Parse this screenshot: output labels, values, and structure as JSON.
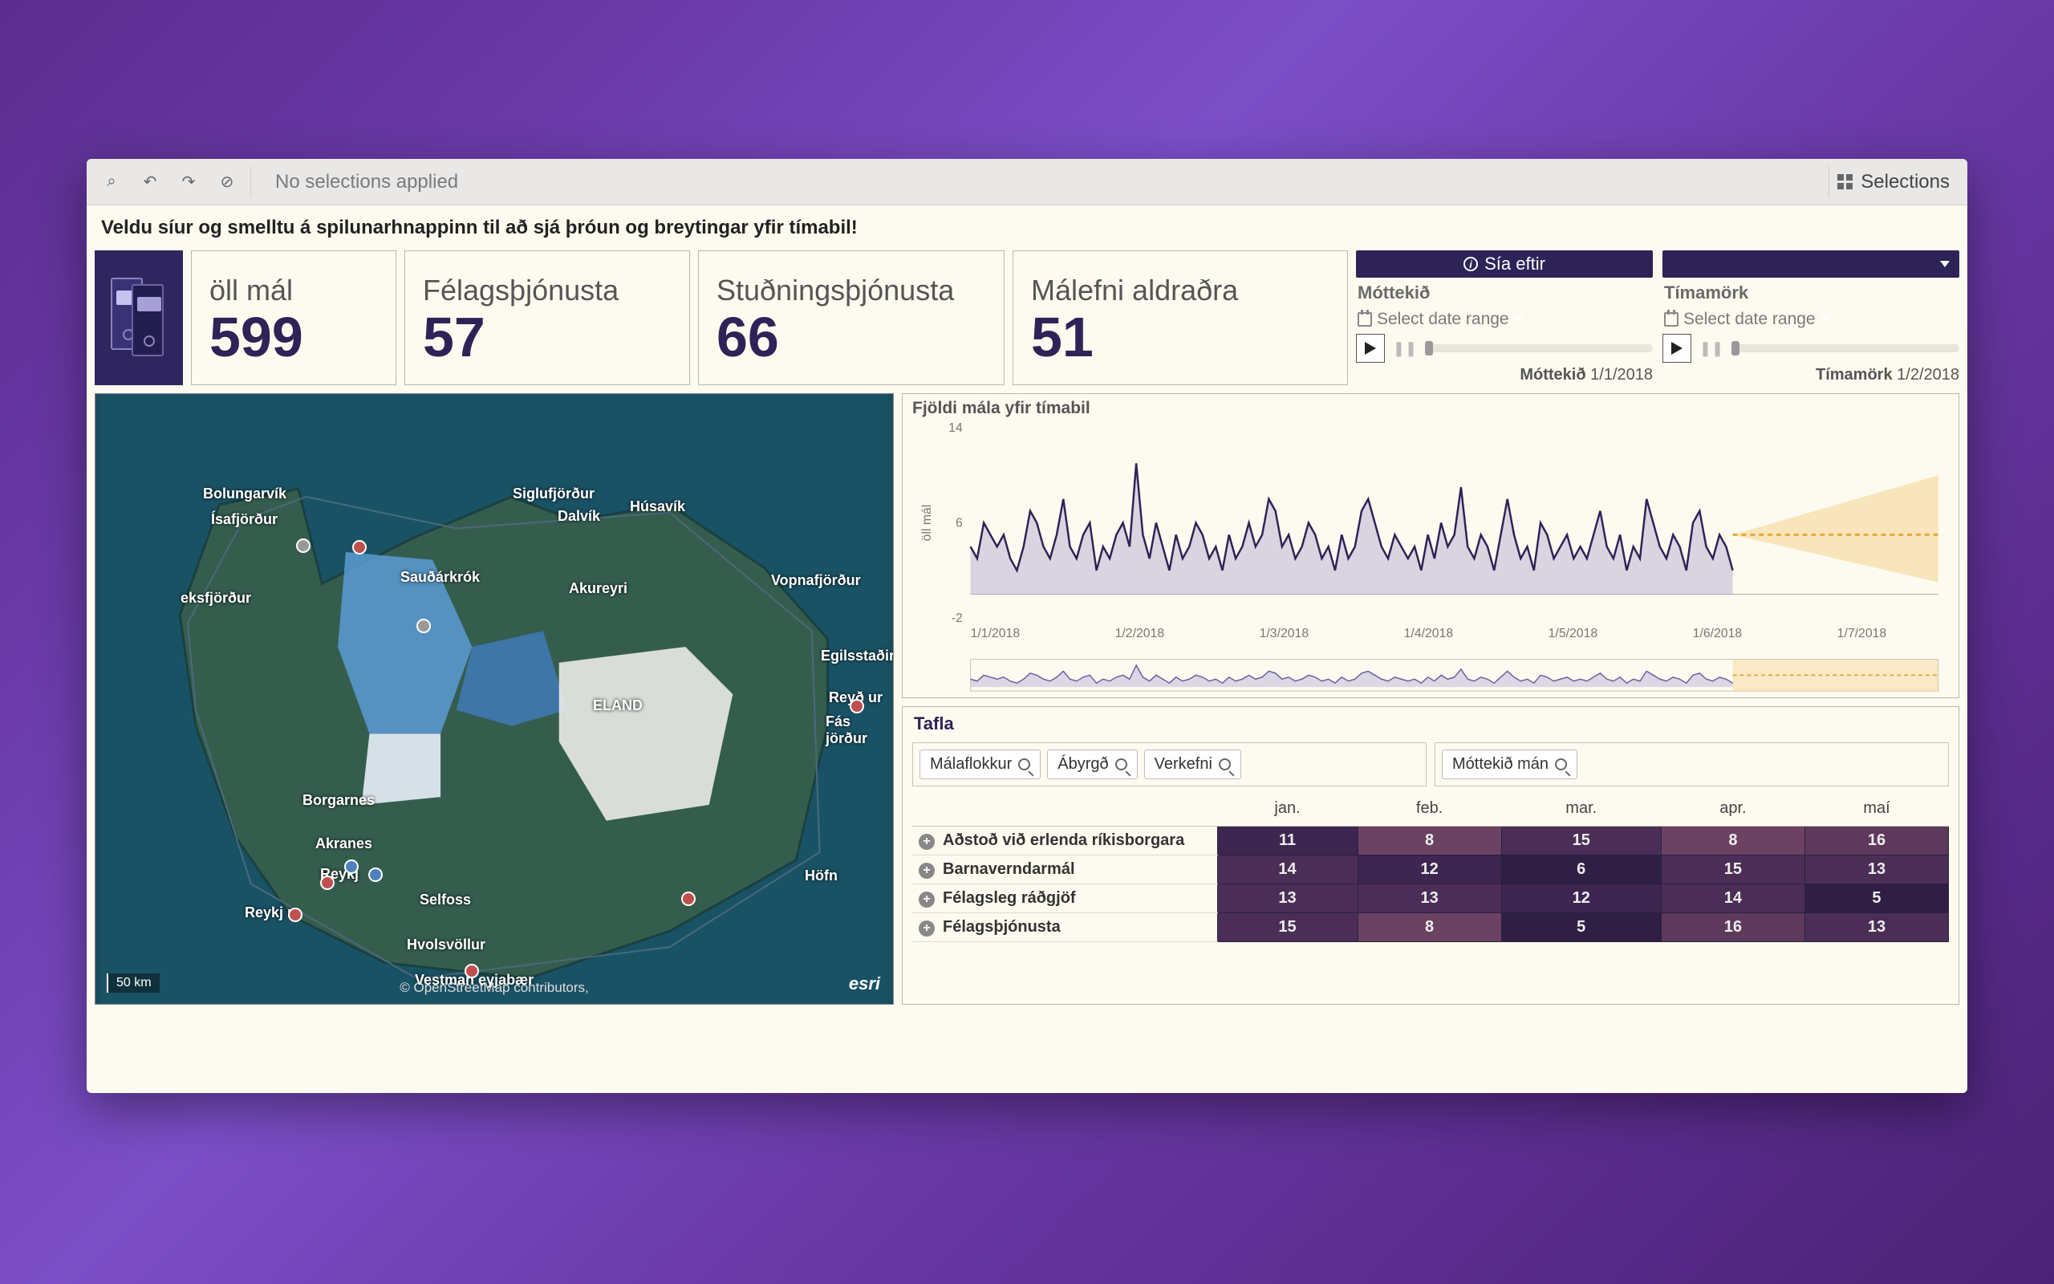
{
  "toolbar": {
    "no_selection": "No selections applied",
    "selections_label": "Selections"
  },
  "instruction": "Veldu síur og smelltu á spilunarhnappinn til að sjá þróun og breytingar yfir tímabil!",
  "kpis": [
    {
      "title": "öll mál",
      "value": "599"
    },
    {
      "title": "Félagsþjónusta",
      "value": "57"
    },
    {
      "title": "Stuðningsþjónusta",
      "value": "66"
    },
    {
      "title": "Málefni aldraðra",
      "value": "51"
    }
  ],
  "filters": {
    "header_left": "Sía eftir",
    "left": {
      "label": "Móttekið",
      "range": "Select date range",
      "date_label": "Móttekið",
      "date_value": "1/1/2018"
    },
    "right": {
      "label": "Tímamörk",
      "range": "Select date range",
      "date_label": "Tímamörk",
      "date_value": "1/2/2018"
    }
  },
  "map": {
    "labels": [
      "Bolungarvík",
      "Ísafjörður",
      "eksfjörður",
      "Siglufjörður",
      "Dalvík",
      "Húsavík",
      "Sauðárkrók",
      "Akureyri",
      "Vopnafjörður",
      "Egilsstaðir",
      "Reyð       ur",
      "Fás        jörður",
      "Borgarnes",
      "Akranes",
      "Reykj",
      "Reykj       r",
      "Selfoss",
      "Höfn",
      "Hvolsvöllur",
      "Vestman   eyjabær",
      "ELAND"
    ],
    "label_pos": [
      [
        134,
        114
      ],
      [
        144,
        146
      ],
      [
        106,
        244
      ],
      [
        520,
        114
      ],
      [
        576,
        142
      ],
      [
        666,
        130
      ],
      [
        380,
        218
      ],
      [
        590,
        232
      ],
      [
        842,
        222
      ],
      [
        904,
        316
      ],
      [
        914,
        368
      ],
      [
        910,
        398
      ],
      [
        258,
        496
      ],
      [
        274,
        550
      ],
      [
        280,
        588
      ],
      [
        186,
        636
      ],
      [
        404,
        620
      ],
      [
        884,
        590
      ],
      [
        388,
        676
      ],
      [
        398,
        720
      ],
      [
        620,
        378
      ]
    ],
    "scale": "50 km",
    "attribution": "© OpenStreetMap contributors,",
    "esri": "esri"
  },
  "chart_data": {
    "title": "Fjöldi mála yfir tímabil",
    "ylabel": "öll mál",
    "y_ticks": [
      -2,
      6,
      14
    ],
    "x_ticks": [
      "1/1/2018",
      "1/2/2018",
      "1/3/2018",
      "1/4/2018",
      "1/5/2018",
      "1/6/2018",
      "1/7/2018"
    ],
    "type": "line",
    "series": [
      {
        "name": "öll mál",
        "values": [
          4,
          3,
          6,
          5,
          4,
          5,
          3,
          2,
          4,
          7,
          6,
          4,
          3,
          5,
          8,
          4,
          3,
          5,
          6,
          2,
          4,
          3,
          5,
          6,
          4,
          11,
          5,
          3,
          6,
          4,
          2,
          5,
          3,
          4,
          6,
          5,
          3,
          4,
          2,
          5,
          3,
          4,
          6,
          4,
          5,
          8,
          7,
          4,
          5,
          3,
          4,
          6,
          5,
          3,
          4,
          2,
          5,
          3,
          4,
          7,
          8,
          6,
          4,
          3,
          5,
          4,
          3,
          4,
          2,
          5,
          3,
          6,
          4,
          5,
          9,
          4,
          3,
          5,
          4,
          2,
          5,
          8,
          5,
          3,
          4,
          2,
          6,
          5,
          3,
          4,
          5,
          3,
          4,
          3,
          5,
          7,
          4,
          3,
          5,
          2,
          4,
          3,
          8,
          6,
          4,
          3,
          5,
          4,
          2,
          6,
          7,
          4,
          3,
          5,
          4,
          2
        ]
      }
    ],
    "forecast_start_index": 115,
    "forecast_mean": 5,
    "ylim": [
      -2,
      14
    ]
  },
  "table": {
    "title": "Tafla",
    "dim_left": [
      "Málaflokkur",
      "Ábyrgð",
      "Verkefni"
    ],
    "dim_right": [
      "Móttekið mán"
    ],
    "columns": [
      "jan.",
      "feb.",
      "mar.",
      "apr.",
      "maí"
    ],
    "rows": [
      {
        "label": "Aðstoð við erlenda ríkisborgara",
        "values": [
          11,
          8,
          15,
          8,
          16
        ]
      },
      {
        "label": "Barnaverndarmál",
        "values": [
          14,
          12,
          6,
          15,
          13
        ]
      },
      {
        "label": "Félagsleg ráðgjöf",
        "values": [
          13,
          13,
          12,
          14,
          5
        ]
      },
      {
        "label": "Félagsþjónusta",
        "values": [
          15,
          8,
          5,
          16,
          13
        ]
      }
    ]
  },
  "heat_palette": [
    "#5d3a5c",
    "#4b2e56",
    "#3d2650",
    "#6b4262",
    "#2f1f44"
  ]
}
